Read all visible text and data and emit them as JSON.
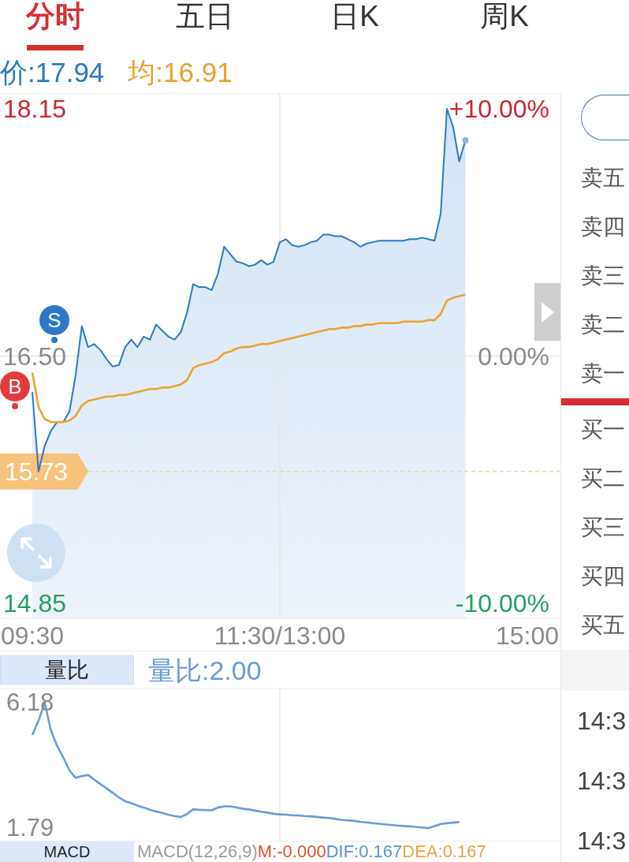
{
  "tabs": [
    {
      "label": "分时",
      "selected": true
    },
    {
      "label": "五日",
      "selected": false
    },
    {
      "label": "日K",
      "selected": false
    },
    {
      "label": "周K",
      "selected": false
    }
  ],
  "price_chart": {
    "chart_data": {
      "type": "line",
      "categories": [
        "09:30",
        null,
        null,
        null,
        null,
        null,
        null,
        null,
        null,
        null,
        null,
        null,
        null,
        null,
        null,
        null,
        null,
        null,
        null,
        null,
        null,
        null,
        null,
        null,
        null,
        null,
        null,
        null,
        null,
        null,
        null,
        null,
        null,
        null,
        null,
        null,
        null,
        null,
        null,
        null,
        "11:30/13:00",
        null,
        null,
        null,
        null,
        null,
        null,
        null,
        null,
        null,
        null,
        null,
        null,
        null,
        null,
        null,
        null,
        null,
        null,
        null,
        null,
        null,
        null,
        null,
        null,
        null,
        null,
        null,
        null,
        null,
        null,
        null,
        null,
        null,
        null,
        null,
        null,
        null,
        null,
        null,
        "15:00"
      ],
      "series": [
        {
          "name": "价:17.94",
          "color": "#2b78c4",
          "values": [
            16.26,
            15.73,
            15.9,
            16.0,
            16.06,
            16.06,
            16.13,
            16.37,
            16.7,
            16.56,
            16.58,
            16.54,
            16.48,
            16.43,
            16.44,
            16.56,
            16.61,
            16.56,
            16.63,
            16.61,
            16.71,
            16.67,
            16.63,
            16.61,
            16.66,
            16.79,
            16.98,
            16.96,
            16.96,
            16.94,
            17.05,
            17.23,
            17.18,
            17.13,
            17.12,
            17.1,
            17.11,
            17.14,
            17.11,
            17.13,
            17.26,
            17.28,
            17.24,
            17.23,
            17.24,
            17.26,
            17.27,
            17.31,
            17.31,
            17.3,
            17.3,
            17.28,
            17.26,
            17.23,
            17.25,
            17.26,
            17.27,
            17.27,
            17.27,
            17.27,
            17.27,
            17.28,
            17.28,
            17.29,
            17.28,
            17.27,
            17.45,
            18.15,
            18.03,
            17.8,
            17.94,
            null,
            null,
            null,
            null,
            null,
            null,
            null,
            null,
            null,
            null
          ]
        },
        {
          "name": "均:16.91",
          "color": "#e8a330",
          "values": [
            16.39,
            16.16,
            16.08,
            16.06,
            16.06,
            16.06,
            16.07,
            16.1,
            16.17,
            16.2,
            16.21,
            16.22,
            16.23,
            16.23,
            16.24,
            16.24,
            16.25,
            16.26,
            16.27,
            16.28,
            16.28,
            16.29,
            16.29,
            16.3,
            16.31,
            16.34,
            16.42,
            16.44,
            16.45,
            16.46,
            16.48,
            16.52,
            16.53,
            16.55,
            16.56,
            16.56,
            16.57,
            16.58,
            16.58,
            16.59,
            16.6,
            16.61,
            16.62,
            16.63,
            16.64,
            16.65,
            16.66,
            16.67,
            16.68,
            16.68,
            16.69,
            16.69,
            16.7,
            16.7,
            16.71,
            16.71,
            16.72,
            16.72,
            16.72,
            16.72,
            16.73,
            16.73,
            16.73,
            16.73,
            16.74,
            16.74,
            16.78,
            16.87,
            16.89,
            16.9,
            16.91,
            null,
            null,
            null,
            null,
            null,
            null,
            null,
            null,
            null,
            null
          ]
        }
      ],
      "ylim": [
        14.75,
        18.25
      ],
      "yticks": [
        {
          "value": 18.15,
          "label": "18.15"
        },
        {
          "value": 16.5,
          "label": "16.50"
        },
        {
          "value": 14.85,
          "label": "14.85"
        }
      ],
      "ref_lines": [
        {
          "axis": "y",
          "value": 15.73,
          "label": "15.73"
        }
      ]
    },
    "right_ticks": [
      {
        "label": "+10.00%"
      },
      {
        "label": "0.00%"
      },
      {
        "label": "-10.00%"
      }
    ],
    "trade_markers": [
      {
        "label": "B",
        "color": "#e23b3b"
      },
      {
        "label": "S",
        "color": "#2b78c8"
      }
    ]
  },
  "indicator": {
    "tab": "量比",
    "chart_data": {
      "type": "line",
      "categories": [
        null,
        null,
        null,
        null,
        null,
        null,
        null,
        null,
        null,
        null,
        null,
        null,
        null,
        null,
        null,
        null,
        null,
        null,
        null,
        null,
        null,
        null,
        null,
        null,
        null,
        null,
        null,
        null,
        null,
        null,
        null,
        null,
        null,
        null,
        null,
        null,
        null,
        null,
        null,
        null,
        null,
        null,
        null,
        null,
        null,
        null,
        null,
        null,
        null,
        null,
        null,
        null,
        null,
        null,
        null,
        null,
        null,
        null,
        null,
        null,
        null,
        null,
        null,
        null,
        null,
        null,
        null,
        null,
        null,
        null,
        null,
        null,
        null,
        null,
        null,
        null,
        null,
        null,
        null,
        null,
        null
      ],
      "series": [
        {
          "name": "量比:2.00",
          "color": "#6a9ad8",
          "values": [
            5.05,
            5.55,
            6.18,
            5.22,
            4.67,
            4.26,
            3.81,
            3.55,
            3.61,
            3.65,
            3.49,
            3.33,
            3.18,
            3.02,
            2.86,
            2.73,
            2.66,
            2.58,
            2.51,
            2.43,
            2.37,
            2.32,
            2.26,
            2.21,
            2.18,
            2.28,
            2.45,
            2.43,
            2.42,
            2.41,
            2.51,
            2.55,
            2.55,
            2.51,
            2.47,
            2.44,
            2.4,
            2.36,
            2.33,
            2.29,
            2.27,
            2.26,
            2.24,
            2.23,
            2.21,
            2.2,
            2.18,
            2.16,
            2.14,
            2.11,
            2.08,
            2.06,
            2.04,
            2.01,
            1.99,
            1.96,
            1.94,
            1.92,
            1.9,
            1.88,
            1.86,
            1.85,
            1.83,
            1.81,
            1.79,
            1.86,
            1.93,
            1.96,
            1.98,
            2.0,
            null,
            null,
            null,
            null,
            null,
            null,
            null,
            null,
            null,
            null,
            null
          ]
        }
      ],
      "ylim": [
        1.32,
        6.65
      ],
      "yticks": [
        {
          "value": 6.18,
          "label": "6.18"
        },
        {
          "value": 1.79,
          "label": "1.79"
        }
      ]
    }
  },
  "macd": {
    "tab": "MACD",
    "readings": [
      {
        "label": "MACD(12,26,9)",
        "color": "#9a9a9a"
      },
      {
        "label": "M:-0.000",
        "color": "#e0502a"
      },
      {
        "label": "DIF:0.167",
        "color": "#5b8fd6"
      },
      {
        "label": "DEA:0.167",
        "color": "#f0a040"
      }
    ]
  },
  "order_book": {
    "asks": [
      {
        "label": "卖五"
      },
      {
        "label": "卖四"
      },
      {
        "label": "卖三"
      },
      {
        "label": "卖二"
      },
      {
        "label": "卖一"
      }
    ],
    "bids": [
      {
        "label": "买一"
      },
      {
        "label": "买二"
      },
      {
        "label": "买三"
      },
      {
        "label": "买四"
      },
      {
        "label": "买五"
      }
    ]
  },
  "trades": [
    {
      "time": "14:3"
    },
    {
      "time": "14:3"
    },
    {
      "time": "14:3"
    }
  ]
}
